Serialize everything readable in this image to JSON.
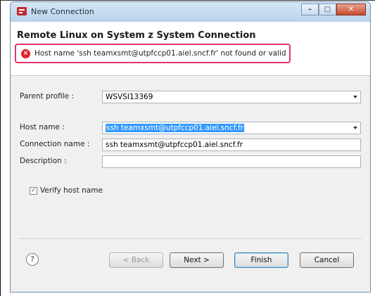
{
  "window": {
    "title": "New Connection",
    "controls": {
      "minimize": "–",
      "maximize": "□",
      "close": "✕"
    }
  },
  "header": {
    "heading": "Remote Linux on System z System Connection",
    "error_message": "Host name 'ssh teamxsmt@utpfccp01.aiel.sncf.fr' not found or valid",
    "error_icon": "×"
  },
  "form": {
    "parent_profile_label": "Parent profile :",
    "parent_profile_value": "WSVSI13369",
    "host_name_label": "Host name :",
    "host_name_value": "ssh teamxsmt@utpfccp01.aiel.sncf.fr",
    "connection_name_label": "Connection name :",
    "connection_name_value": "ssh teamxsmt@utpfccp01.aiel.sncf.fr",
    "description_label": "Description :",
    "description_value": "",
    "verify_label": "Verify host name",
    "verify_checked": "✓"
  },
  "footer": {
    "help_icon": "?",
    "back_label": "< Back",
    "next_label": "Next >",
    "finish_label": "Finish",
    "cancel_label": "Cancel"
  },
  "colors": {
    "error_border": "#e0346c",
    "error_icon": "#d7262b",
    "selection": "#3399ff"
  }
}
